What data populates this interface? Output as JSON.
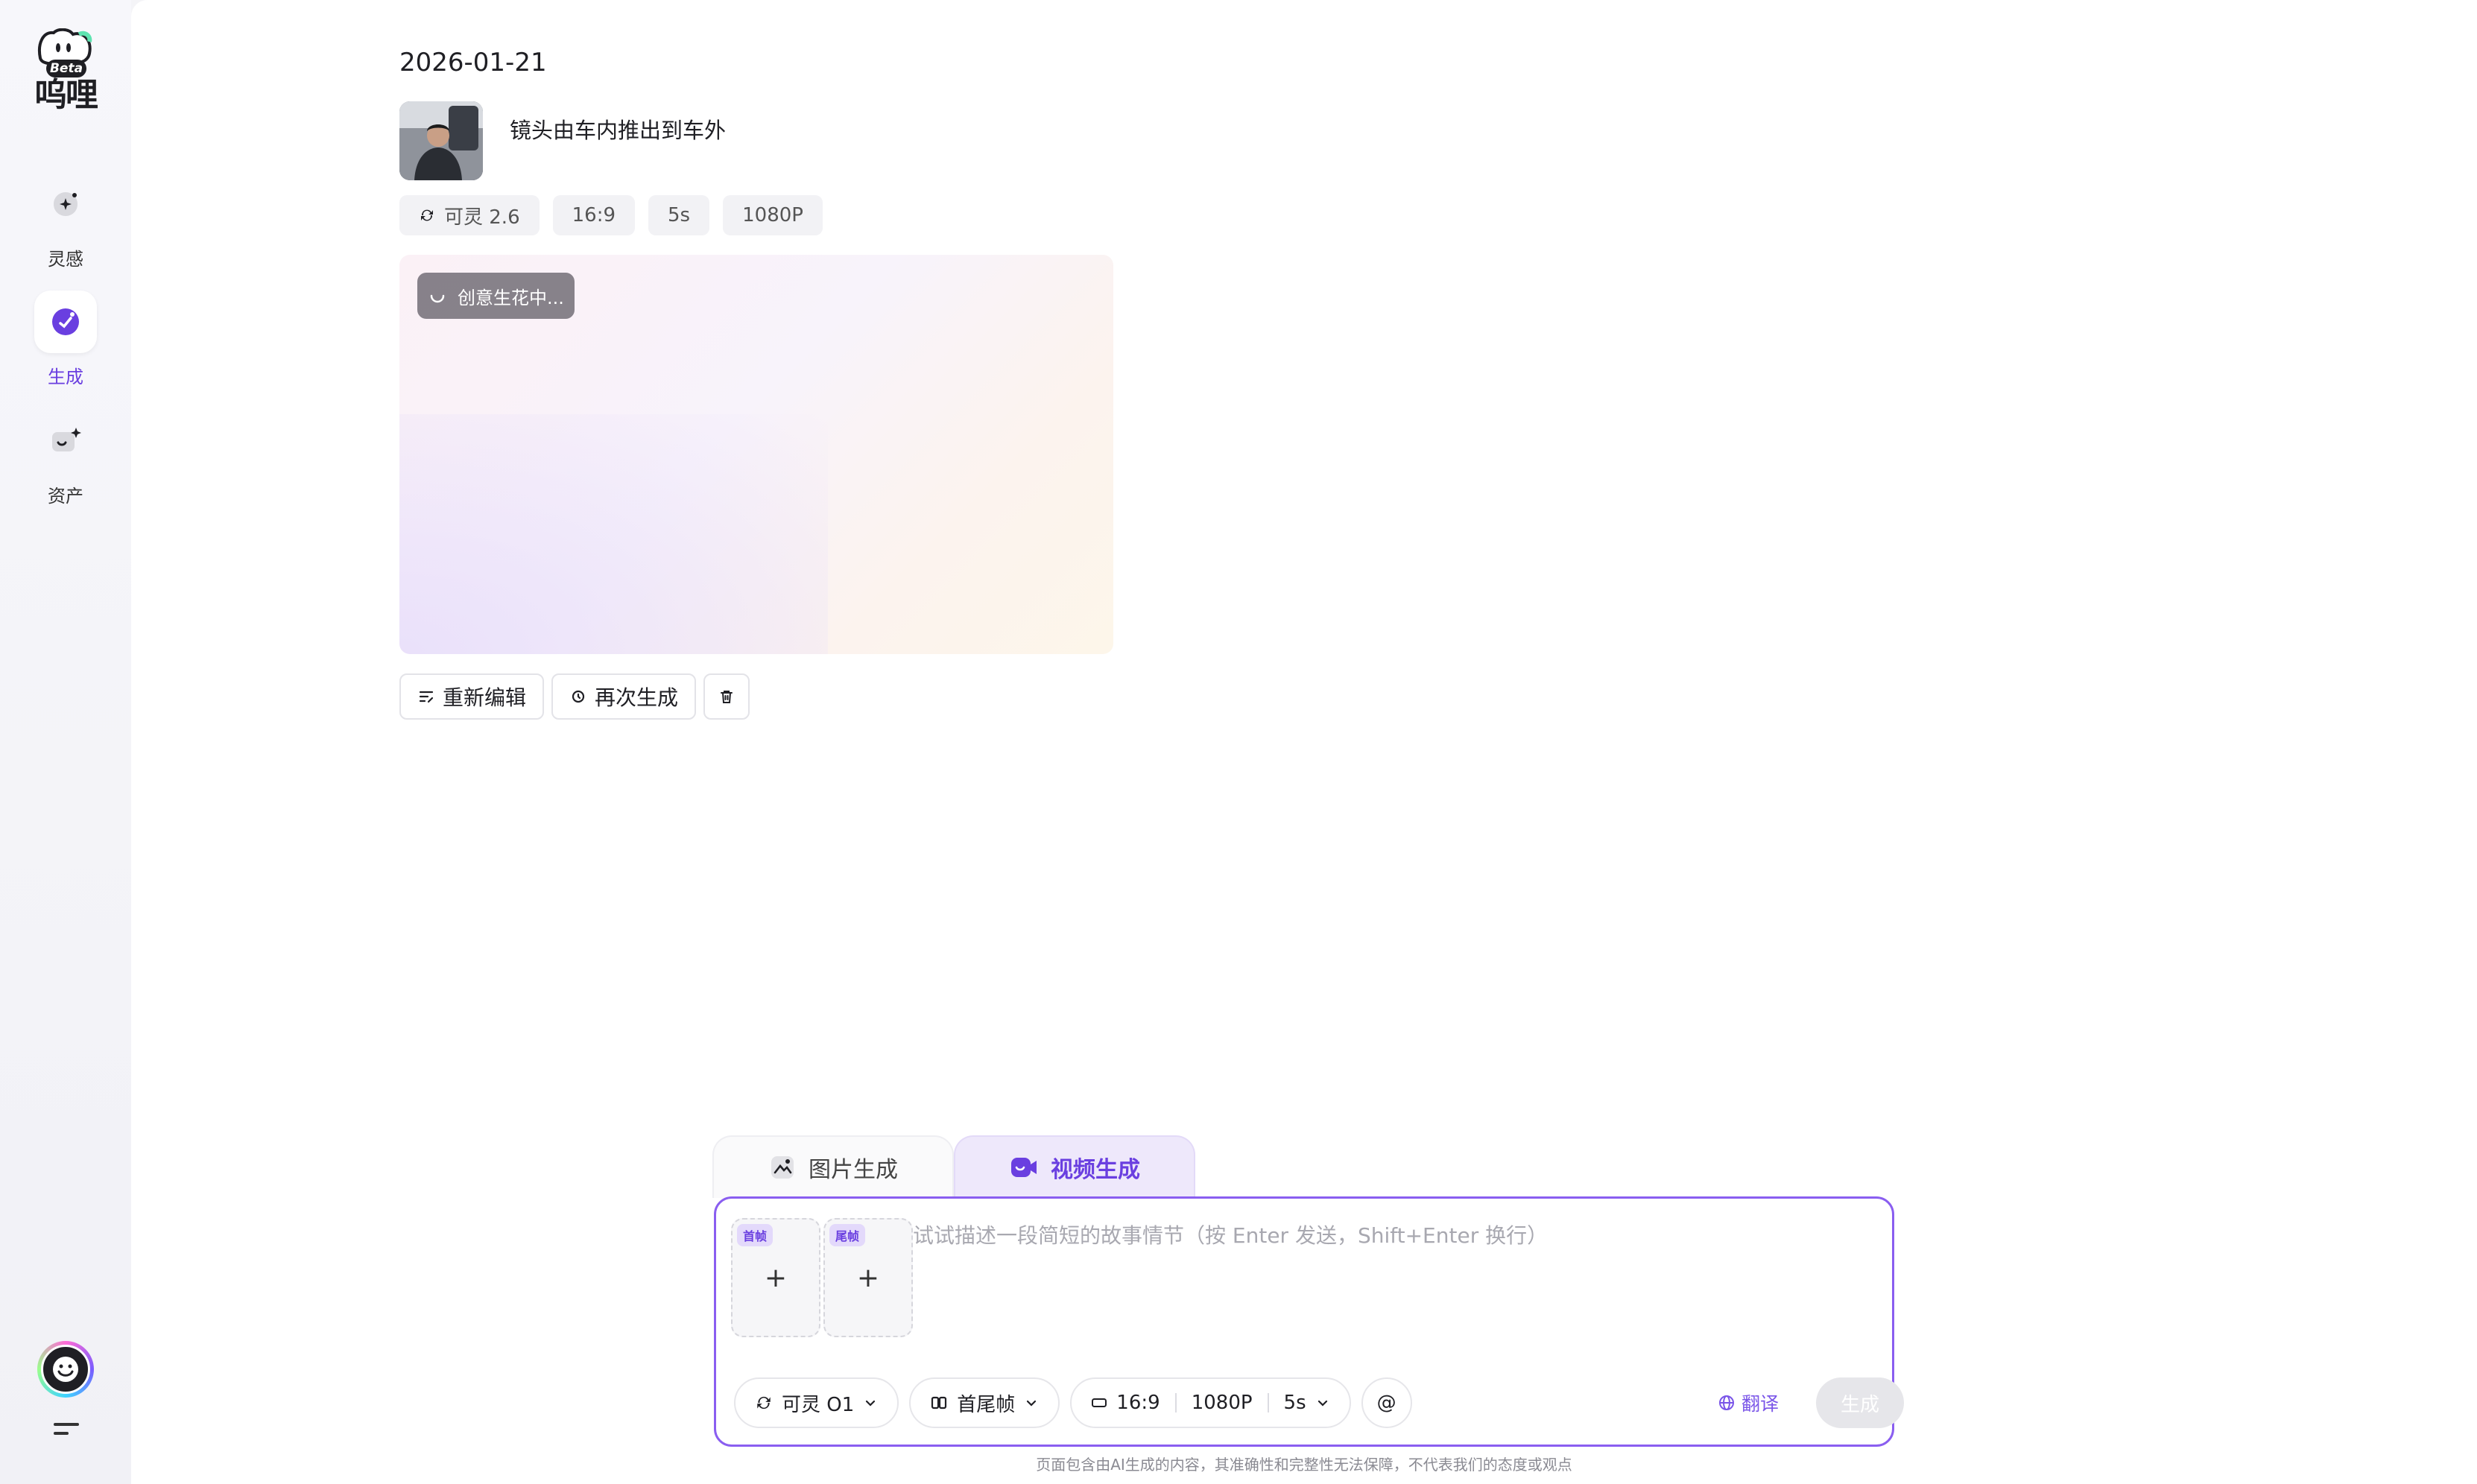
{
  "sidebar": {
    "logo": {
      "badge": "Beta",
      "wordmark": "呜哩"
    },
    "items": [
      {
        "label": "灵感",
        "icon": "sparkle-icon",
        "active": false
      },
      {
        "label": "生成",
        "icon": "generate-icon",
        "active": true
      },
      {
        "label": "资产",
        "icon": "assets-icon",
        "active": false
      }
    ]
  },
  "history": {
    "date": "2026-01-21",
    "prompt": "镜头由车内推出到车外",
    "chips": {
      "model": "可灵 2.6",
      "ratio": "16:9",
      "duration": "5s",
      "resolution": "1080P"
    },
    "status": "创意生花中...",
    "actions": {
      "reedit": "重新编辑",
      "regenerate": "再次生成"
    }
  },
  "composer": {
    "tabs": {
      "image": "图片生成",
      "video": "视频生成"
    },
    "frames": {
      "first": "首帧",
      "last": "尾帧",
      "plus": "+"
    },
    "placeholder": "试试描述一段简短的故事情节（按 Enter 发送，Shift+Enter 换行）",
    "tools": {
      "model": "可灵 O1",
      "mode": "首尾帧",
      "ratio": "16:9",
      "resolution": "1080P",
      "duration": "5s",
      "mention": "@"
    },
    "translate": "翻译",
    "generate": "生成"
  },
  "disclaimer": "页面包含由AI生成的内容，其准确性和完整性无法保障，不代表我们的态度或观点",
  "colors": {
    "accent": "#6a3fe0",
    "composer_border": "#8a5ef0"
  }
}
